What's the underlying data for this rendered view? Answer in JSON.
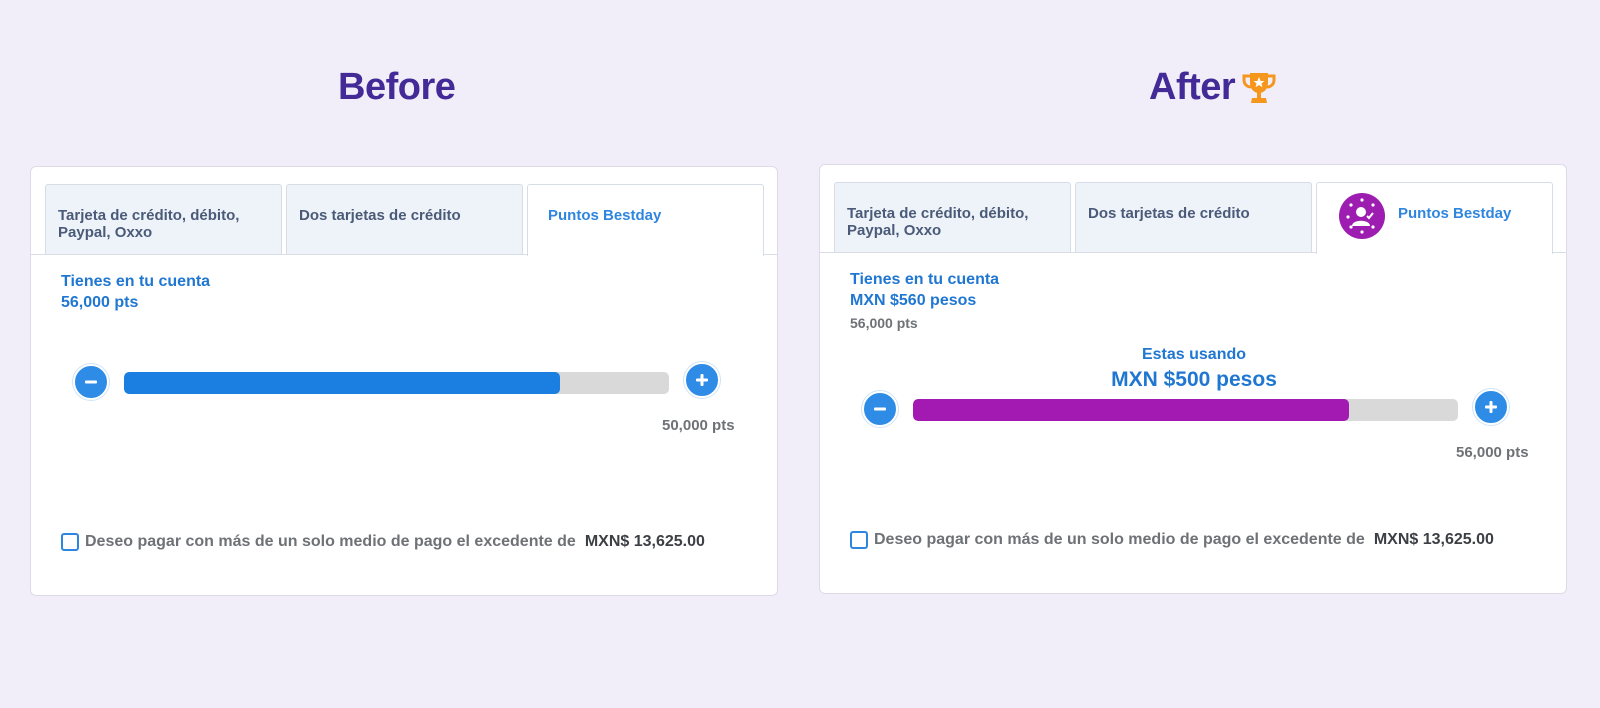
{
  "headings": {
    "before": "Before",
    "after": "After"
  },
  "before_panel": {
    "tabs": [
      {
        "line1": "Tarjeta de crédito, débito,",
        "line2": "Paypal, Oxxo"
      },
      {
        "label": "Dos tarjetas de crédito"
      },
      {
        "label": "Puntos Bestday",
        "active": true
      }
    ],
    "account_title": "Tienes en tu cuenta",
    "account_value": "56,000 pts",
    "slider": {
      "fraction": 0.8,
      "fill_color": "#1a7fe0",
      "value_text": "50,000 pts"
    },
    "checkbox_label": "Deseo pagar con más de un solo medio de pago el excedente de",
    "checkbox_amount": "MXN$ 13,625.00"
  },
  "after_panel": {
    "tabs": [
      {
        "line1": "Tarjeta de crédito, débito,",
        "line2": "Paypal, Oxxo"
      },
      {
        "label": "Dos tarjetas de crédito"
      },
      {
        "label": "Puntos Bestday",
        "active": true,
        "badge_icon": "loyalty-user-star-icon"
      }
    ],
    "account_title": "Tienes en tu cuenta",
    "account_value": "MXN $560 pesos",
    "account_points": "56,000 pts",
    "using_label": "Estas usando",
    "using_amount": "MXN $500 pesos",
    "slider": {
      "fraction": 0.8,
      "fill_color": "#a21ab2",
      "value_text": "56,000 pts"
    },
    "checkbox_label": "Deseo pagar con más de un solo medio de pago el excedente de",
    "checkbox_amount": "MXN$ 13,625.00"
  },
  "icons": {
    "trophy": "trophy-icon",
    "minus": "minus-icon",
    "plus": "plus-icon"
  },
  "colors": {
    "heading": "#432a96",
    "accent_blue": "#2f8ce6",
    "trophy": "#f5961d",
    "badge": "#9c1db0"
  }
}
